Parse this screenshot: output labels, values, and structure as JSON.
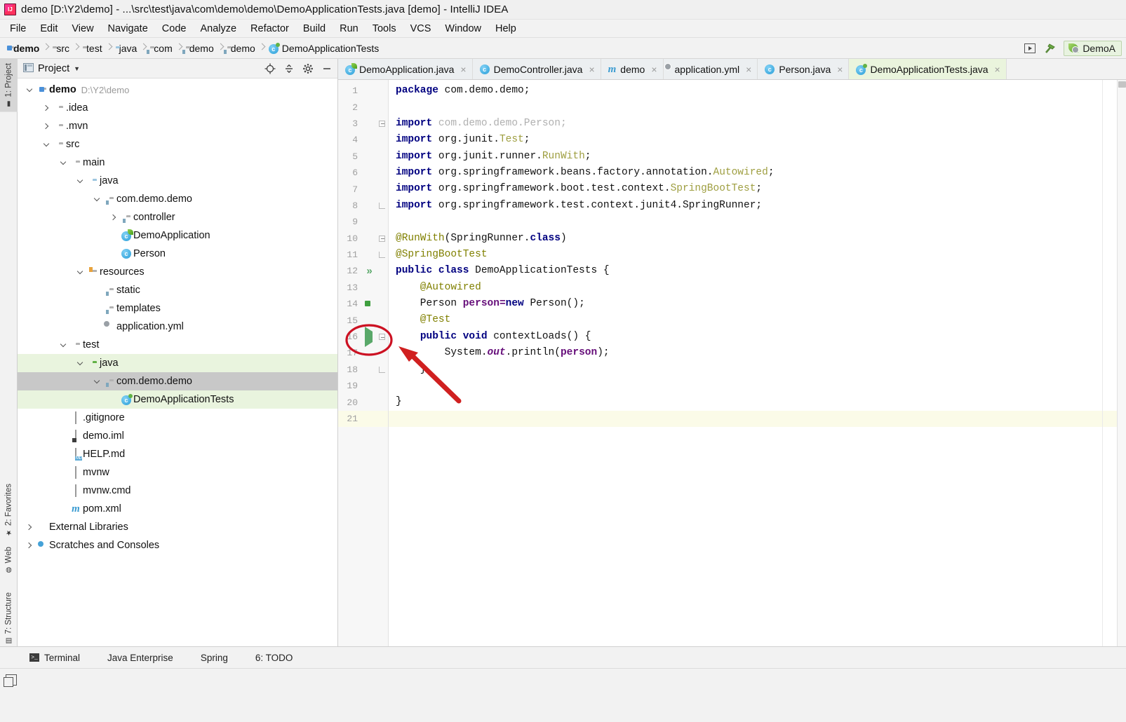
{
  "window": {
    "title": "demo [D:\\Y2\\demo] - ...\\src\\test\\java\\com\\demo\\demo\\DemoApplicationTests.java [demo] - IntelliJ IDEA",
    "logo_icon": "intellij-idea-logo"
  },
  "menubar": {
    "items": [
      {
        "label": "File"
      },
      {
        "label": "Edit"
      },
      {
        "label": "View"
      },
      {
        "label": "Navigate"
      },
      {
        "label": "Code"
      },
      {
        "label": "Analyze"
      },
      {
        "label": "Refactor"
      },
      {
        "label": "Build"
      },
      {
        "label": "Run"
      },
      {
        "label": "Tools"
      },
      {
        "label": "VCS"
      },
      {
        "label": "Window"
      },
      {
        "label": "Help"
      }
    ]
  },
  "navbar": {
    "crumbs": [
      {
        "label": "demo",
        "icon": "module-folder-icon"
      },
      {
        "label": "src",
        "icon": "folder-icon"
      },
      {
        "label": "test",
        "icon": "folder-icon"
      },
      {
        "label": "java",
        "icon": "source-root-folder-icon"
      },
      {
        "label": "com",
        "icon": "package-icon"
      },
      {
        "label": "demo",
        "icon": "package-icon"
      },
      {
        "label": "demo",
        "icon": "package-icon"
      },
      {
        "label": "DemoApplicationTests",
        "icon": "java-test-class-icon"
      }
    ],
    "right_buttons": [
      {
        "name": "run-configurations-icon",
        "glyph": "▶"
      },
      {
        "name": "build-hammer-icon",
        "glyph": "⚒"
      }
    ],
    "run_config": {
      "label": "DemoA",
      "icon": "spring-boot-icon"
    }
  },
  "left_tool_strip": {
    "tabs": [
      {
        "label": "1: Project",
        "icon": "project-icon",
        "active": true
      },
      {
        "label": "2: Favorites",
        "icon": "star-icon",
        "active": false
      },
      {
        "label": "Web",
        "icon": "web-globe-icon",
        "active": false
      },
      {
        "label": "7: Structure",
        "icon": "structure-icon",
        "active": false
      }
    ]
  },
  "project_panel": {
    "header": {
      "title": "Project",
      "dropdown_icon": "chevron-down-icon",
      "view_icon": "project-view-icon",
      "tools": [
        {
          "name": "scroll-from-source-icon",
          "glyph": "⊕"
        },
        {
          "name": "collapse-all-icon",
          "glyph": "≡"
        },
        {
          "name": "settings-gear-icon",
          "glyph": "⚙"
        },
        {
          "name": "hide-panel-icon",
          "glyph": "—"
        }
      ]
    },
    "tree": [
      {
        "label": "demo",
        "path": "D:\\Y2\\demo",
        "indent": 0,
        "arrow": "down",
        "icon": "module-folder-icon",
        "bold": true,
        "highlight": "none"
      },
      {
        "label": ".idea",
        "indent": 1,
        "arrow": "right",
        "icon": "folder-icon",
        "highlight": "none"
      },
      {
        "label": ".mvn",
        "indent": 1,
        "arrow": "right",
        "icon": "folder-icon",
        "highlight": "none"
      },
      {
        "label": "src",
        "indent": 1,
        "arrow": "down",
        "icon": "folder-icon",
        "highlight": "none"
      },
      {
        "label": "main",
        "indent": 2,
        "arrow": "down",
        "icon": "folder-icon",
        "highlight": "none"
      },
      {
        "label": "java",
        "indent": 3,
        "arrow": "down",
        "icon": "source-root-folder-icon",
        "highlight": "none"
      },
      {
        "label": "com.demo.demo",
        "indent": 4,
        "arrow": "down",
        "icon": "package-icon",
        "highlight": "none"
      },
      {
        "label": "controller",
        "indent": 5,
        "arrow": "right",
        "icon": "package-icon",
        "highlight": "none"
      },
      {
        "label": "DemoApplication",
        "indent": 5,
        "arrow": "none",
        "icon": "spring-boot-class-icon",
        "highlight": "none"
      },
      {
        "label": "Person",
        "indent": 5,
        "arrow": "none",
        "icon": "java-class-icon",
        "highlight": "none"
      },
      {
        "label": "resources",
        "indent": 3,
        "arrow": "down",
        "icon": "resources-root-icon",
        "highlight": "none"
      },
      {
        "label": "static",
        "indent": 4,
        "arrow": "none",
        "icon": "package-icon",
        "highlight": "none"
      },
      {
        "label": "templates",
        "indent": 4,
        "arrow": "none",
        "icon": "package-icon",
        "highlight": "none"
      },
      {
        "label": "application.yml",
        "indent": 4,
        "arrow": "none",
        "icon": "spring-yaml-icon",
        "highlight": "none"
      },
      {
        "label": "test",
        "indent": 2,
        "arrow": "down",
        "icon": "folder-icon",
        "highlight": "none"
      },
      {
        "label": "java",
        "indent": 3,
        "arrow": "down",
        "icon": "test-source-root-folder-icon",
        "highlight": "green"
      },
      {
        "label": "com.demo.demo",
        "indent": 4,
        "arrow": "down",
        "icon": "test-package-icon",
        "highlight": "selected"
      },
      {
        "label": "DemoApplicationTests",
        "indent": 5,
        "arrow": "none",
        "icon": "java-test-class-icon",
        "highlight": "green"
      },
      {
        "label": ".gitignore",
        "indent": 2,
        "arrow": "none",
        "icon": "text-file-icon",
        "highlight": "none"
      },
      {
        "label": "demo.iml",
        "indent": 2,
        "arrow": "none",
        "icon": "iml-file-icon",
        "highlight": "none"
      },
      {
        "label": "HELP.md",
        "indent": 2,
        "arrow": "none",
        "icon": "markdown-file-icon",
        "highlight": "none"
      },
      {
        "label": "mvnw",
        "indent": 2,
        "arrow": "none",
        "icon": "text-file-icon",
        "highlight": "none"
      },
      {
        "label": "mvnw.cmd",
        "indent": 2,
        "arrow": "none",
        "icon": "text-file-icon",
        "highlight": "none"
      },
      {
        "label": "pom.xml",
        "indent": 2,
        "arrow": "none",
        "icon": "maven-file-icon",
        "highlight": "none"
      },
      {
        "label": "External Libraries",
        "indent": 0,
        "arrow": "right",
        "icon": "libraries-icon",
        "highlight": "none"
      },
      {
        "label": "Scratches and Consoles",
        "indent": 0,
        "arrow": "right",
        "icon": "scratches-icon",
        "highlight": "none"
      }
    ]
  },
  "editor": {
    "tabs": [
      {
        "label": "DemoApplication.java",
        "icon": "spring-boot-class-icon",
        "active": false
      },
      {
        "label": "DemoController.java",
        "icon": "java-class-icon",
        "active": false
      },
      {
        "label": "demo",
        "icon": "maven-file-icon",
        "active": false
      },
      {
        "label": "application.yml",
        "icon": "spring-yaml-icon",
        "active": false
      },
      {
        "label": "Person.java",
        "icon": "java-class-icon",
        "active": false
      },
      {
        "label": "DemoApplicationTests.java",
        "icon": "java-test-class-icon",
        "active": true
      }
    ],
    "caret_line": 21,
    "gutter": [
      {
        "line": 1,
        "icon": "none",
        "fold": "none"
      },
      {
        "line": 2,
        "icon": "none",
        "fold": "none"
      },
      {
        "line": 3,
        "icon": "none",
        "fold": "fold-minus"
      },
      {
        "line": 4,
        "icon": "none",
        "fold": "none"
      },
      {
        "line": 5,
        "icon": "none",
        "fold": "none"
      },
      {
        "line": 6,
        "icon": "none",
        "fold": "none"
      },
      {
        "line": 7,
        "icon": "none",
        "fold": "none"
      },
      {
        "line": 8,
        "icon": "none",
        "fold": "fold-end"
      },
      {
        "line": 9,
        "icon": "none",
        "fold": "none"
      },
      {
        "line": 10,
        "icon": "none",
        "fold": "fold-minus"
      },
      {
        "line": 11,
        "icon": "spring-leaf-icon",
        "fold": "fold-end"
      },
      {
        "line": 12,
        "icon": "run-all-tests-icon",
        "fold": "none"
      },
      {
        "line": 13,
        "icon": "none",
        "fold": "none"
      },
      {
        "line": 14,
        "icon": "autowired-bean-icon",
        "fold": "none"
      },
      {
        "line": 15,
        "icon": "none",
        "fold": "none"
      },
      {
        "line": 16,
        "icon": "run-test-method-icon",
        "fold": "fold-minus"
      },
      {
        "line": 17,
        "icon": "none",
        "fold": "none"
      },
      {
        "line": 18,
        "icon": "none",
        "fold": "fold-end"
      },
      {
        "line": 19,
        "icon": "none",
        "fold": "none"
      },
      {
        "line": 20,
        "icon": "none",
        "fold": "none"
      },
      {
        "line": 21,
        "icon": "none",
        "fold": "none"
      }
    ],
    "code_lines": [
      {
        "n": 1,
        "tokens": [
          {
            "t": "package ",
            "c": "kw"
          },
          {
            "t": "com.demo.demo;",
            "c": "plain"
          }
        ]
      },
      {
        "n": 2,
        "tokens": []
      },
      {
        "n": 3,
        "tokens": [
          {
            "t": "import ",
            "c": "kw"
          },
          {
            "t": "com.demo.demo.Person;",
            "c": "grey"
          }
        ]
      },
      {
        "n": 4,
        "tokens": [
          {
            "t": "import ",
            "c": "kw"
          },
          {
            "t": "org.junit.",
            "c": "plain"
          },
          {
            "t": "Test",
            "c": "ann"
          },
          {
            "t": ";",
            "c": "plain"
          }
        ]
      },
      {
        "n": 5,
        "tokens": [
          {
            "t": "import ",
            "c": "kw"
          },
          {
            "t": "org.junit.runner.",
            "c": "plain"
          },
          {
            "t": "RunWith",
            "c": "ann"
          },
          {
            "t": ";",
            "c": "plain"
          }
        ]
      },
      {
        "n": 6,
        "tokens": [
          {
            "t": "import ",
            "c": "kw"
          },
          {
            "t": "org.springframework.beans.factory.annotation.",
            "c": "plain"
          },
          {
            "t": "Autowired",
            "c": "ann"
          },
          {
            "t": ";",
            "c": "plain"
          }
        ]
      },
      {
        "n": 7,
        "tokens": [
          {
            "t": "import ",
            "c": "kw"
          },
          {
            "t": "org.springframework.boot.test.context.",
            "c": "plain"
          },
          {
            "t": "SpringBootTest",
            "c": "ann"
          },
          {
            "t": ";",
            "c": "plain"
          }
        ]
      },
      {
        "n": 8,
        "tokens": [
          {
            "t": "import ",
            "c": "kw"
          },
          {
            "t": "org.springframework.test.context.junit4.SpringRunner;",
            "c": "plain"
          }
        ]
      },
      {
        "n": 9,
        "tokens": []
      },
      {
        "n": 10,
        "tokens": [
          {
            "t": "@RunWith",
            "c": "ann-strong"
          },
          {
            "t": "(SpringRunner.",
            "c": "plain"
          },
          {
            "t": "class",
            "c": "kw"
          },
          {
            "t": ")",
            "c": "plain"
          }
        ]
      },
      {
        "n": 11,
        "tokens": [
          {
            "t": "@SpringBootTest",
            "c": "ann-strong"
          }
        ]
      },
      {
        "n": 12,
        "tokens": [
          {
            "t": "public class ",
            "c": "kw"
          },
          {
            "t": "DemoApplicationTests {",
            "c": "plain"
          }
        ]
      },
      {
        "n": 13,
        "tokens": [
          {
            "t": "    @Autowired",
            "c": "ann-strong"
          }
        ]
      },
      {
        "n": 14,
        "tokens": [
          {
            "t": "    Person ",
            "c": "plain"
          },
          {
            "t": "person",
            "c": "field"
          },
          {
            "t": "=",
            "c": "field"
          },
          {
            "t": "new",
            "c": "kw"
          },
          {
            "t": " Person();",
            "c": "plain"
          }
        ]
      },
      {
        "n": 15,
        "tokens": [
          {
            "t": "    @Test",
            "c": "ann-strong"
          }
        ]
      },
      {
        "n": 16,
        "tokens": [
          {
            "t": "    ",
            "c": "plain"
          },
          {
            "t": "public void ",
            "c": "kw"
          },
          {
            "t": "contextLoads() {",
            "c": "plain"
          }
        ]
      },
      {
        "n": 17,
        "tokens": [
          {
            "t": "        System.",
            "c": "plain"
          },
          {
            "t": "out",
            "c": "static-it"
          },
          {
            "t": ".println(",
            "c": "plain"
          },
          {
            "t": "person",
            "c": "field"
          },
          {
            "t": ");",
            "c": "plain"
          }
        ]
      },
      {
        "n": 18,
        "tokens": [
          {
            "t": "    }",
            "c": "plain"
          }
        ]
      },
      {
        "n": 19,
        "tokens": []
      },
      {
        "n": 20,
        "tokens": [
          {
            "t": "}",
            "c": "plain"
          }
        ]
      },
      {
        "n": 21,
        "tokens": []
      }
    ]
  },
  "annotation": {
    "ellipse_color": "#cc1122",
    "arrow_color": "#d02020",
    "target": "run-test-method-gutter-icon-line-16"
  },
  "bottombar": {
    "items": [
      {
        "label": "Terminal",
        "icon": "terminal-icon"
      },
      {
        "label": "Java Enterprise",
        "icon": "none"
      },
      {
        "label": "Spring",
        "icon": "spring-leaf-icon"
      },
      {
        "label": "6: TODO",
        "icon": "todo-list-icon"
      }
    ]
  },
  "statusbar": {
    "icon": "show-tool-windows-icon"
  }
}
